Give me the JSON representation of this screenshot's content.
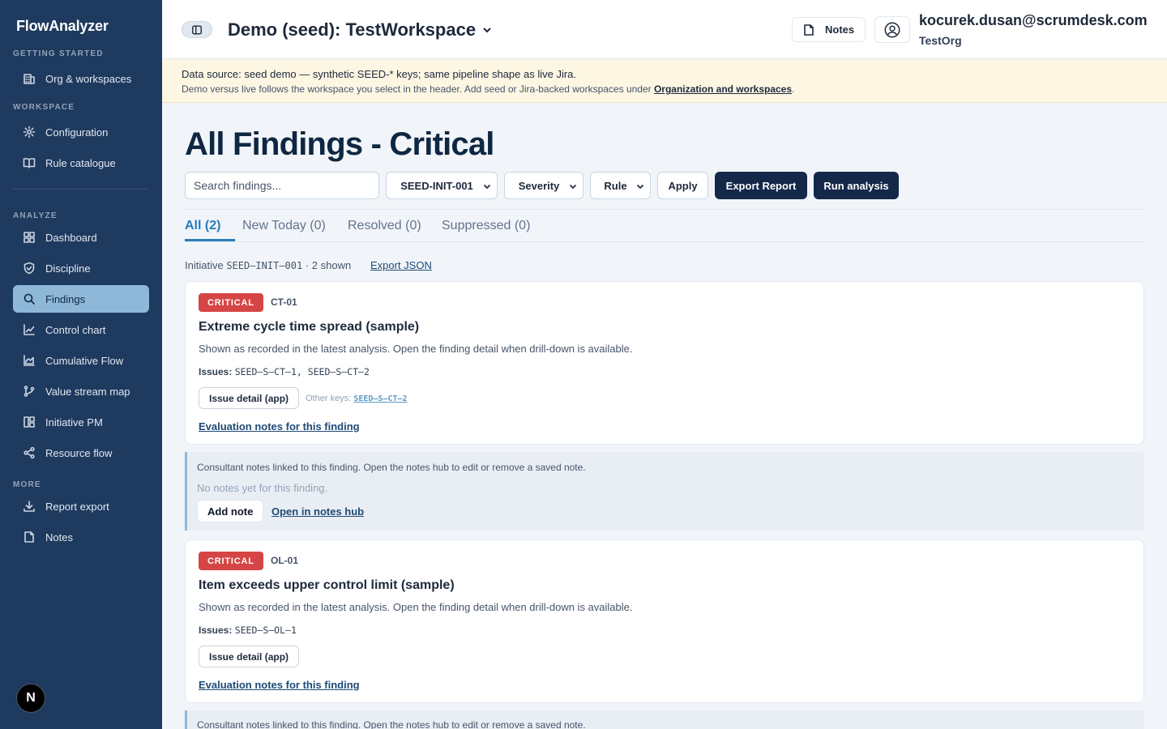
{
  "sidebar": {
    "brand": "FlowAnalyzer",
    "sections": {
      "getting_started": "GETTING STARTED",
      "workspace": "WORKSPACE",
      "analyze": "ANALYZE",
      "more": "MORE"
    },
    "items": [
      {
        "label": "Org & workspaces",
        "icon": "building-icon"
      },
      {
        "label": "Configuration",
        "icon": "gear-icon"
      },
      {
        "label": "Rule catalogue",
        "icon": "book-icon"
      },
      {
        "label": "Dashboard",
        "icon": "dashboard-icon"
      },
      {
        "label": "Discipline",
        "icon": "shield-check-icon"
      },
      {
        "label": "Findings",
        "icon": "search-icon",
        "active": true
      },
      {
        "label": "Control chart",
        "icon": "line-chart-icon"
      },
      {
        "label": "Cumulative Flow",
        "icon": "area-chart-icon"
      },
      {
        "label": "Value stream map",
        "icon": "git-branch-icon"
      },
      {
        "label": "Initiative PM",
        "icon": "columns-icon"
      },
      {
        "label": "Resource flow",
        "icon": "share-icon"
      },
      {
        "label": "Report export",
        "icon": "download-icon"
      },
      {
        "label": "Notes",
        "icon": "note-icon"
      }
    ],
    "footer_badge": "N"
  },
  "header": {
    "workspace_title": "Demo (seed): TestWorkspace",
    "notes_label": "Notes",
    "user_email": "kocurek.dusan@scrumdesk.com",
    "user_org": "TestOrg"
  },
  "banner": {
    "line1": "Data source: seed demo — synthetic SEED-* keys; same pipeline shape as live Jira.",
    "line2_prefix": "Demo versus live follows the workspace you select in the header. Add seed or Jira-backed workspaces under ",
    "line2_link": "Organization and workspaces",
    "line2_suffix": "."
  },
  "main": {
    "title": "All Findings - Critical",
    "search_placeholder": "Search findings...",
    "filters": {
      "initiative": "SEED-INIT-001",
      "severity": "Severity",
      "rule": "Rule",
      "apply": "Apply",
      "export_report": "Export Report",
      "run_analysis": "Run analysis"
    },
    "tabs": [
      {
        "label": "All (2)",
        "active": true
      },
      {
        "label": "New Today (0)"
      },
      {
        "label": "Resolved (0)"
      },
      {
        "label": "Suppressed (0)"
      }
    ],
    "meta_prefix": "Initiative ",
    "meta_initiative": "SEED–INIT–001",
    "meta_suffix": " · 2 shown",
    "export_json": "Export JSON",
    "findings": [
      {
        "severity": "CRITICAL",
        "rule": "CT-01",
        "title": "Extreme cycle time spread (sample)",
        "description": "Shown as recorded in the latest analysis. Open the finding detail when drill-down is available.",
        "issues_label": "Issues:",
        "issues": "SEED–S–CT–1, SEED–S–CT–2",
        "issue_button": "Issue detail (app)",
        "other_keys_label": "Other keys:",
        "other_keys": "SEED–S–CT–2",
        "eval_link": "Evaluation notes for this finding",
        "notes_hint": "Consultant notes linked to this finding. Open the notes hub to edit or remove a saved note.",
        "notes_empty": "No notes yet for this finding.",
        "add_note": "Add note",
        "open_hub": "Open in notes hub"
      },
      {
        "severity": "CRITICAL",
        "rule": "OL-01",
        "title": "Item exceeds upper control limit (sample)",
        "description": "Shown as recorded in the latest analysis. Open the finding detail when drill-down is available.",
        "issues_label": "Issues:",
        "issues": "SEED–S–OL–1",
        "issue_button": "Issue detail (app)",
        "eval_link": "Evaluation notes for this finding",
        "notes_hint": "Consultant notes linked to this finding. Open the notes hub to edit or remove a saved note."
      }
    ]
  },
  "colors": {
    "sidebar_bg": "#1e3a5f",
    "active_nav": "#8fb8d8",
    "primary_dark": "#14284a",
    "critical": "#d64545",
    "accent_tab": "#2b7bb9",
    "banner_bg": "#fdf6e3"
  }
}
